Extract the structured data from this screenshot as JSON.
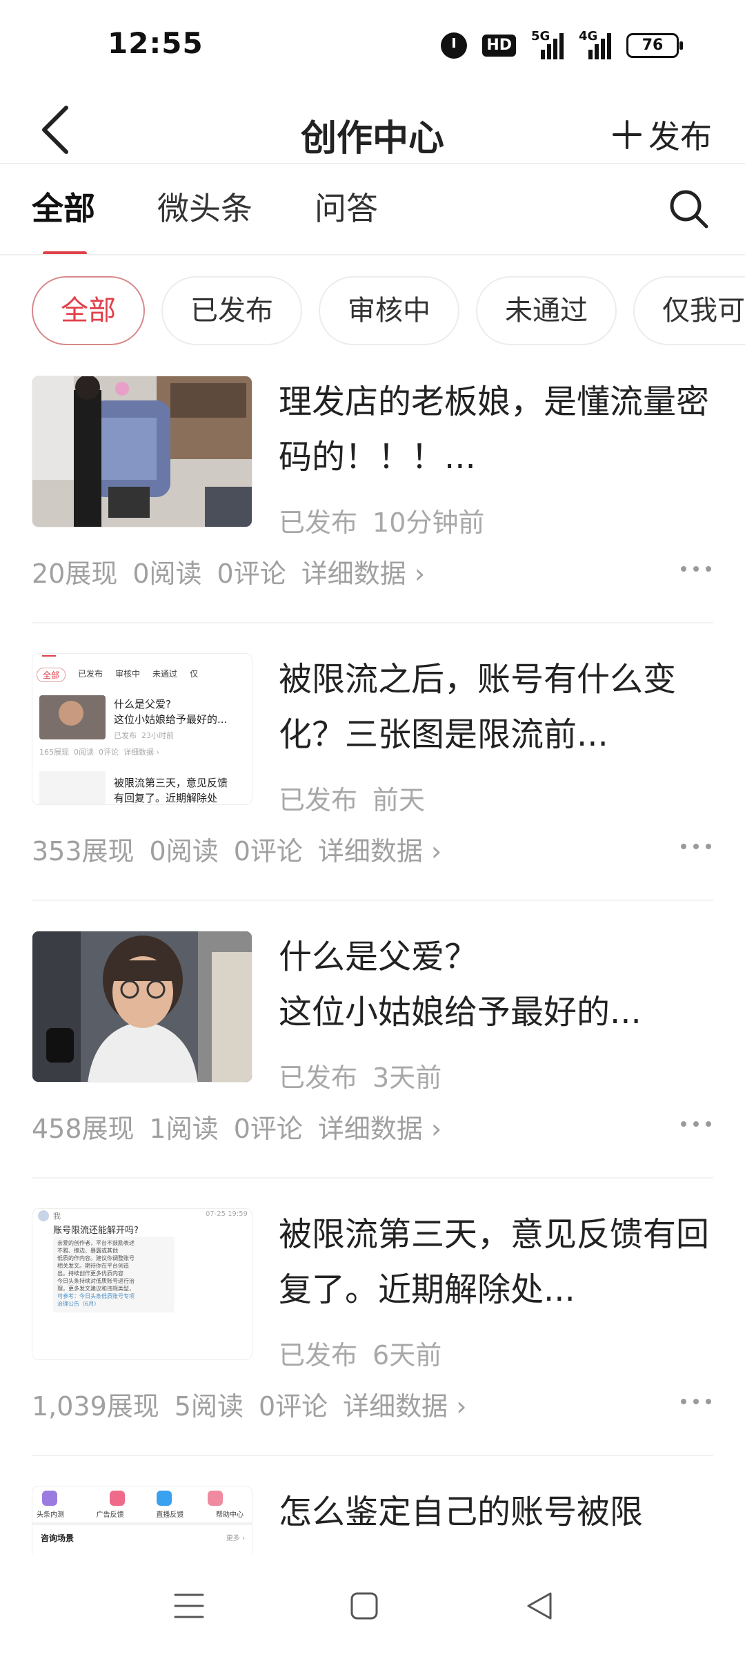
{
  "status": {
    "time": "12:55",
    "hd_label": "HD",
    "net1": "5G",
    "net2": "4G",
    "battery": "76",
    "icons": [
      "alarm-icon",
      "hd-voice-icon",
      "signal-5g-icon",
      "signal-4g-icon",
      "battery-icon"
    ]
  },
  "header": {
    "title": "创作中心",
    "publish_label": "发布",
    "back_icon": "back-icon",
    "plus_icon": "plus-icon"
  },
  "tabs": [
    {
      "label": "全部",
      "active": true
    },
    {
      "label": "微头条",
      "active": false
    },
    {
      "label": "问答",
      "active": false
    }
  ],
  "filters": [
    {
      "label": "全部",
      "active": true
    },
    {
      "label": "已发布",
      "active": false
    },
    {
      "label": "审核中",
      "active": false
    },
    {
      "label": "未通过",
      "active": false
    },
    {
      "label": "仅我可见",
      "active": false
    }
  ],
  "articles": [
    {
      "title": "理发店的老板娘，是懂流量密码的！！！...",
      "status": "已发布",
      "time": "10分钟前",
      "views": "20展现",
      "reads": "0阅读",
      "comments": "0评论",
      "detail": "详细数据 ›"
    },
    {
      "title": "被限流之后，账号有什么变化？三张图是限流前...",
      "status": "已发布",
      "time": "前天",
      "views": "353展现",
      "reads": "0阅读",
      "comments": "0评论",
      "detail": "详细数据 ›"
    },
    {
      "title": "什么是父爱？\n这位小姑娘给予最好的...",
      "status": "已发布",
      "time": "3天前",
      "views": "458展现",
      "reads": "1阅读",
      "comments": "0评论",
      "detail": "详细数据 ›"
    },
    {
      "title": "被限流第三天，意见反馈有回复了。近期解除处...",
      "status": "已发布",
      "time": "6天前",
      "views": "1,039展现",
      "reads": "5阅读",
      "comments": "0评论",
      "detail": "详细数据 ›"
    },
    {
      "title": "怎么鉴定自己的账号被限"
    }
  ],
  "thumb2": {
    "chips": [
      "全部",
      "已发布",
      "审核中",
      "未通过",
      "仅"
    ],
    "title1": "什么是父爱?",
    "title2": "这位小姑娘给予最好的...",
    "meta": "已发布  23小时前",
    "stats": "165展现  0阅读  0评论  详细数据 ›",
    "next_title1": "被限流第三天，意见反馈",
    "next_title2": "有回复了。近期解除处"
  },
  "thumb4": {
    "sender": "我",
    "date": "07-25 19:59",
    "question": "账号限流还能解开吗?",
    "reply": [
      "亲爱的创作者，平台不鼓励表述",
      "不雅、擦边、暴露或其他",
      "低质的作内容。建议你调整账号",
      "相关发文。期待你在平台创造",
      "出。持续创作更多优质内容",
      "今日头条持续对低质账号进行治",
      "理，更多发文建议和违规类型，",
      "可参考：今日头条低质账号专项",
      "治理公告（6月）"
    ]
  },
  "thumb5": {
    "items": [
      "头条内测",
      "广告反馈",
      "直播反馈",
      "帮助中心"
    ],
    "section": "咨询场景",
    "more": "更多 ›"
  },
  "nav": {
    "icons": [
      "menu-icon",
      "home-square-icon",
      "back-triangle-icon"
    ]
  }
}
